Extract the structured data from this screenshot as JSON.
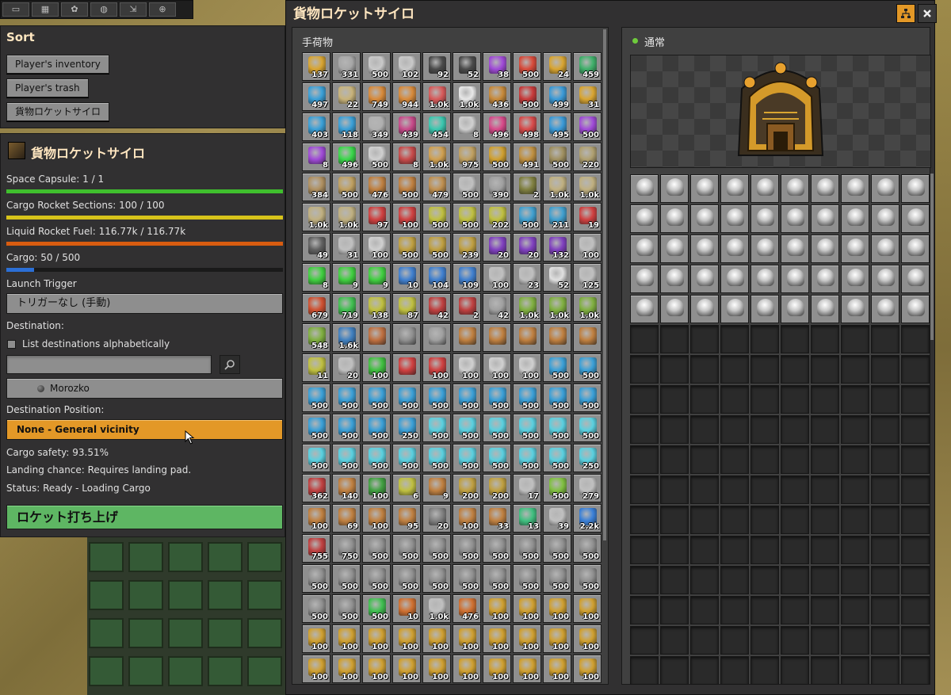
{
  "sort_panel": {
    "title": "Sort",
    "buttons": [
      "Player's inventory",
      "Player's trash",
      "貨物ロケットサイロ"
    ]
  },
  "silo_panel": {
    "title": "貨物ロケットサイロ",
    "space_capsule": "Space Capsule: 1 / 1",
    "space_capsule_fill": 1.0,
    "cargo_sections": "Cargo Rocket Sections: 100 / 100",
    "cargo_sections_fill": 1.0,
    "fuel": "Liquid Rocket Fuel: 116.77k / 116.77k",
    "fuel_fill": 1.0,
    "cargo": "Cargo: 50 / 500",
    "cargo_fill": 0.1,
    "launch_trigger_label": "Launch Trigger",
    "launch_trigger_value": "トリガーなし (手動)",
    "destination_label": "Destination:",
    "list_alpha_label": "List destinations alphabetically",
    "destination_value": "Morozko",
    "dest_position_label": "Destination Position:",
    "dest_position_value": "None - General vicinity",
    "cargo_safety": "Cargo safety: 93.51%",
    "landing_chance": "Landing chance: Requires landing pad.",
    "status": "Status: Ready - Loading Cargo",
    "launch_button": "ロケット打ち上げ"
  },
  "main_window": {
    "title": "貨物ロケットサイロ",
    "inventory_header": "手荷物",
    "status_label": "通常"
  },
  "colors": {
    "bar_green": "#3fbf2d",
    "bar_yellow": "#d7c31a",
    "bar_orange": "#d85c10",
    "bar_blue": "#2b6fd6",
    "orange_button": "#e39827",
    "launch_green": "#5eb663"
  },
  "inventory": [
    [
      "137",
      "331",
      "500",
      "102",
      "92",
      "52",
      "38",
      "500",
      "24",
      "459"
    ],
    [
      "497",
      "22",
      "749",
      "944",
      "1.0k",
      "1.0k",
      "436",
      "500",
      "499",
      "31"
    ],
    [
      "403",
      "118",
      "349",
      "439",
      "454",
      "8",
      "496",
      "498",
      "495",
      "500"
    ],
    [
      "8",
      "496",
      "500",
      "8",
      "1.0k",
      "975",
      "500",
      "491",
      "500",
      "220"
    ],
    [
      "384",
      "500",
      "476",
      "500",
      "479",
      "500",
      "390",
      "2",
      "1.0k",
      "1.0k"
    ],
    [
      "1.0k",
      "1.0k",
      "97",
      "100",
      "500",
      "500",
      "202",
      "500",
      "211",
      "19"
    ],
    [
      "49",
      "31",
      "100",
      "500",
      "500",
      "239",
      "20",
      "20",
      "132",
      "100"
    ],
    [
      "8",
      "9",
      "9",
      "10",
      "104",
      "109",
      "100",
      "23",
      "52",
      "125"
    ],
    [
      "679",
      "719",
      "138",
      "87",
      "42",
      "2",
      "42",
      "1.0k",
      "1.0k",
      "1.0k"
    ],
    [
      "548",
      "1.6k",
      "",
      "",
      "",
      "",
      "",
      "",
      "",
      ""
    ],
    [
      "11",
      "20",
      "100",
      "",
      "100",
      "100",
      "100",
      "100",
      "500",
      "500"
    ],
    [
      "500",
      "500",
      "500",
      "500",
      "500",
      "500",
      "500",
      "500",
      "500",
      "500"
    ],
    [
      "500",
      "500",
      "500",
      "250",
      "500",
      "500",
      "500",
      "500",
      "500",
      "500"
    ],
    [
      "500",
      "500",
      "500",
      "500",
      "500",
      "500",
      "500",
      "500",
      "500",
      "250"
    ],
    [
      "362",
      "140",
      "100",
      "6",
      "9",
      "200",
      "200",
      "17",
      "500",
      "279"
    ],
    [
      "100",
      "69",
      "100",
      "95",
      "20",
      "100",
      "33",
      "13",
      "39",
      "2.2k"
    ],
    [
      "755",
      "750",
      "500",
      "500",
      "500",
      "500",
      "500",
      "500",
      "500",
      "500"
    ],
    [
      "500",
      "500",
      "500",
      "500",
      "500",
      "500",
      "500",
      "500",
      "500",
      "500"
    ],
    [
      "500",
      "500",
      "500",
      "10",
      "1.0k",
      "476",
      "100",
      "100",
      "100",
      "100"
    ],
    [
      "100",
      "100",
      "100",
      "100",
      "100",
      "100",
      "100",
      "100",
      "100",
      "100"
    ],
    [
      "100",
      "100",
      "100",
      "100",
      "100",
      "100",
      "100",
      "100",
      "100",
      "100"
    ]
  ],
  "icon_colors": [
    [
      "#d9a531",
      "#a7a7a7",
      "#c9c9c9",
      "#c9c9c9",
      "#4a4a4a",
      "#4a4a4a",
      "#a04ad8",
      "#d84a3a",
      "#d9a531",
      "#3fb06a"
    ],
    [
      "#3aa0d8",
      "#c8b37a",
      "#d88a3a",
      "#d88a3a",
      "#d85a5a",
      "#e8e8e8",
      "#c88a3a",
      "#c83a3a",
      "#3a9ad8",
      "#d9a531"
    ],
    [
      "#3aa0d8",
      "#3aa0d8",
      "#b0b0b0",
      "#c84a8a",
      "#3ac8b0",
      "#d0d0d0",
      "#d84a8a",
      "#d84a4a",
      "#3a9ad8",
      "#a04ad8"
    ],
    [
      "#a04ad8",
      "#3ad84a",
      "#d0d0d0",
      "#c84a4a",
      "#d0a050",
      "#c0a060",
      "#d0a030",
      "#c09040",
      "#a09060",
      "#b0a070"
    ],
    [
      "#b09060",
      "#c0a060",
      "#c08040",
      "#c08040",
      "#c09050",
      "#c0c0c0",
      "#a0a0a0",
      "#808040",
      "#c0b080",
      "#c0b080"
    ],
    [
      "#c0b080",
      "#c0b080",
      "#d04040",
      "#d04040",
      "#c0c040",
      "#c0c040",
      "#c0c040",
      "#40a0d0",
      "#40a0d0",
      "#d04040"
    ],
    [
      "#606060",
      "#c0c0c0",
      "#d0d0d0",
      "#c0a040",
      "#c0a040",
      "#c0a040",
      "#8040c0",
      "#8040c0",
      "#8040c0",
      "#c0c0c0"
    ],
    [
      "#40d040",
      "#40d040",
      "#40d040",
      "#4080d0",
      "#4080d0",
      "#4080d0",
      "#c0c0c0",
      "#c0c0c0",
      "#e0e0e0",
      "#c0c0c0"
    ],
    [
      "#d05030",
      "#40c050",
      "#c0c040",
      "#c0c040",
      "#c04040",
      "#c04040",
      "#a0a0a0",
      "#80b040",
      "#80b040",
      "#80b040"
    ],
    [
      "#80b040",
      "#4080c0",
      "#c07040",
      "#909090",
      "#a0a0a0",
      "#c08040",
      "#c08040",
      "#c08040",
      "#c08040",
      "#c08040"
    ],
    [
      "#c0c040",
      "#c0c0c0",
      "#40c040",
      "#d04040",
      "#d04040",
      "#d0d0d0",
      "#d0d0d0",
      "#d0d0d0",
      "#3aa0d8",
      "#3aa0d8"
    ],
    [
      "#3aa0d8",
      "#3aa0d8",
      "#3aa0d8",
      "#3aa0d8",
      "#3aa0d8",
      "#3aa0d8",
      "#3aa0d8",
      "#3aa0d8",
      "#3aa0d8",
      "#3aa0d8"
    ],
    [
      "#3aa0d8",
      "#3aa0d8",
      "#3aa0d8",
      "#3aa0d8",
      "#5ad0e0",
      "#5ad0e0",
      "#5ad0e0",
      "#5ad0e0",
      "#5ad0e0",
      "#5ad0e0"
    ],
    [
      "#5ad0e0",
      "#5ad0e0",
      "#5ad0e0",
      "#5ad0e0",
      "#5ad0e0",
      "#5ad0e0",
      "#5ad0e0",
      "#5ad0e0",
      "#5ad0e0",
      "#5ad0e0"
    ],
    [
      "#c04040",
      "#c08040",
      "#40a040",
      "#c0c040",
      "#c08040",
      "#c0a040",
      "#c0a040",
      "#c0c0c0",
      "#80c040",
      "#c0c0c0"
    ],
    [
      "#c08040",
      "#c08040",
      "#c08040",
      "#c08040",
      "#808080",
      "#c08040",
      "#c08040",
      "#40c080",
      "#c0c0c0",
      "#3a80d8"
    ],
    [
      "#c04040",
      "#909090",
      "#909090",
      "#909090",
      "#909090",
      "#909090",
      "#909090",
      "#909090",
      "#909090",
      "#909090"
    ],
    [
      "#909090",
      "#909090",
      "#909090",
      "#909090",
      "#909090",
      "#909090",
      "#909090",
      "#909090",
      "#909090",
      "#909090"
    ],
    [
      "#909090",
      "#909090",
      "#40c050",
      "#d07030",
      "#c0c0c0",
      "#d07030",
      "#d0a030",
      "#d0a030",
      "#d0a030",
      "#d0a030"
    ],
    [
      "#d0a030",
      "#d0a030",
      "#d0a030",
      "#d0a030",
      "#d0a030",
      "#d0a030",
      "#d0a030",
      "#d0a030",
      "#d0a030",
      "#d0a030"
    ],
    [
      "#d0a030",
      "#d0a030",
      "#d0a030",
      "#d0a030",
      "#d0a030",
      "#d0a030",
      "#d0a030",
      "#d0a030",
      "#d0a030",
      "#d0a030"
    ]
  ],
  "cargo_slots": {
    "filled": 50,
    "total": 170,
    "item_icon": "cargo-pod-icon",
    "item_color": "#c8c8c8"
  }
}
